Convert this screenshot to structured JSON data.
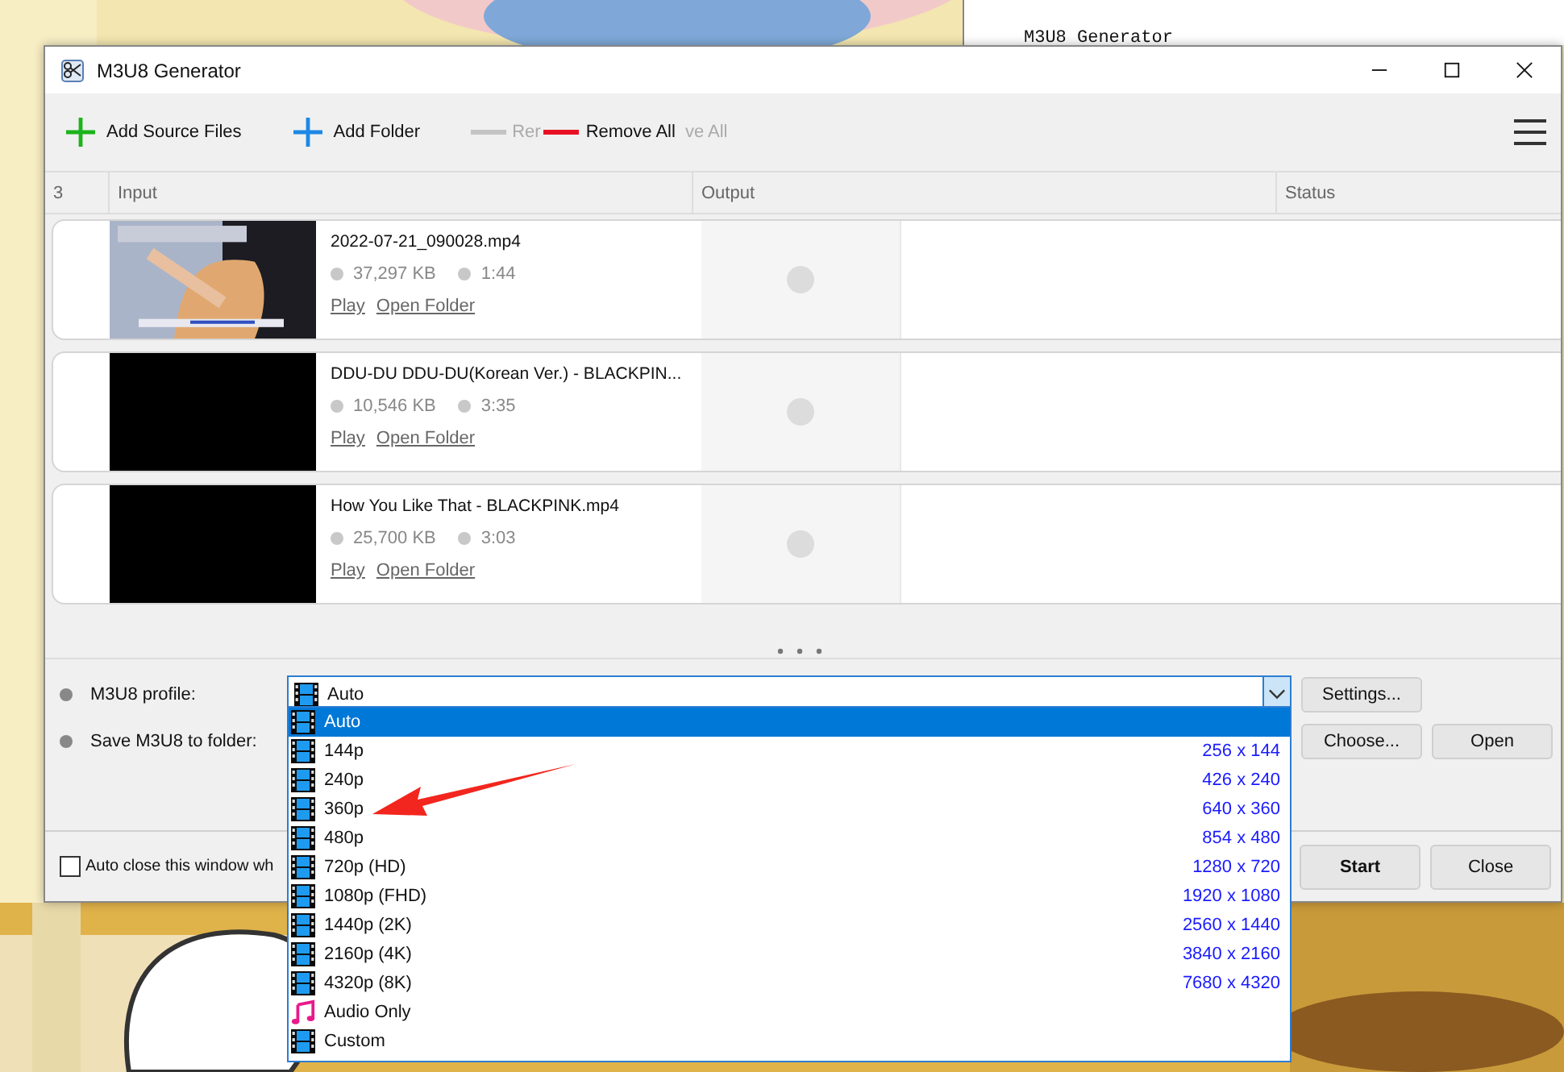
{
  "background_window": {
    "title": "M3U8 Generator"
  },
  "window": {
    "title": "M3U8 Generator"
  },
  "toolbar": [
    {
      "kind": "plus",
      "color": "#1bb31b",
      "label": "Add Source Files",
      "disabled": false
    },
    {
      "kind": "plus",
      "color": "#1e88e5",
      "label": "Add Folder",
      "disabled": false
    },
    {
      "kind": "minus",
      "color": "#c4c4c4",
      "label": "Rer",
      "disabled": true
    },
    {
      "kind": "minus",
      "color": "#e81123",
      "label": "Remove All",
      "disabled": false
    },
    {
      "kind": "text",
      "label": "ve All",
      "disabled": true
    }
  ],
  "table": {
    "count": "3",
    "columns": [
      "Input",
      "Output",
      "Status"
    ],
    "rows": [
      {
        "kind": "picture",
        "name": "2022-07-21_090028.mp4",
        "size": "37,297 KB",
        "duration": "1:44",
        "actions": [
          "Play",
          "Open Folder"
        ]
      },
      {
        "kind": "blank",
        "name": "DDU-DU DDU-DU(Korean Ver.) - BLACKPIN...",
        "size": "10,546 KB",
        "duration": "3:35",
        "actions": [
          "Play",
          "Open Folder"
        ]
      },
      {
        "kind": "blank",
        "name": "How You Like That - BLACKPINK.mp4",
        "size": "25,700 KB",
        "duration": "3:03",
        "actions": [
          "Play",
          "Open Folder"
        ]
      }
    ]
  },
  "form": {
    "profile_label": "M3U8 profile:",
    "profile_value": "Auto",
    "settings_button": "Settings...",
    "folder_label": "Save M3U8 to folder:",
    "choose_button": "Choose...",
    "open_button": "Open"
  },
  "footer": {
    "auto_close": {
      "label": "Auto close this window wh",
      "checked": false
    },
    "buttons": [
      "Start",
      "Close"
    ]
  },
  "dropdown": [
    {
      "kind": "video",
      "label": "Auto",
      "selected": true
    },
    {
      "kind": "video",
      "label": "144p",
      "resolution": "256 x 144",
      "selected": false
    },
    {
      "kind": "video",
      "label": "240p",
      "resolution": "426 x 240",
      "selected": false
    },
    {
      "kind": "video",
      "label": "360p",
      "resolution": "640 x 360",
      "selected": false
    },
    {
      "kind": "video",
      "label": "480p",
      "resolution": "854 x 480",
      "selected": false
    },
    {
      "kind": "video",
      "label": "720p (HD)",
      "resolution": "1280 x 720",
      "selected": false
    },
    {
      "kind": "video",
      "label": "1080p (FHD)",
      "resolution": "1920 x 1080",
      "selected": false
    },
    {
      "kind": "video",
      "label": "1440p (2K)",
      "resolution": "2560 x 1440",
      "selected": false
    },
    {
      "kind": "video",
      "label": "2160p (4K)",
      "resolution": "3840 x 2160",
      "selected": false
    },
    {
      "kind": "video",
      "label": "4320p (8K)",
      "resolution": "7680 x 4320",
      "selected": false
    },
    {
      "kind": "audio",
      "label": "Audio Only",
      "selected": false
    },
    {
      "kind": "video",
      "label": "Custom",
      "selected": false
    }
  ]
}
